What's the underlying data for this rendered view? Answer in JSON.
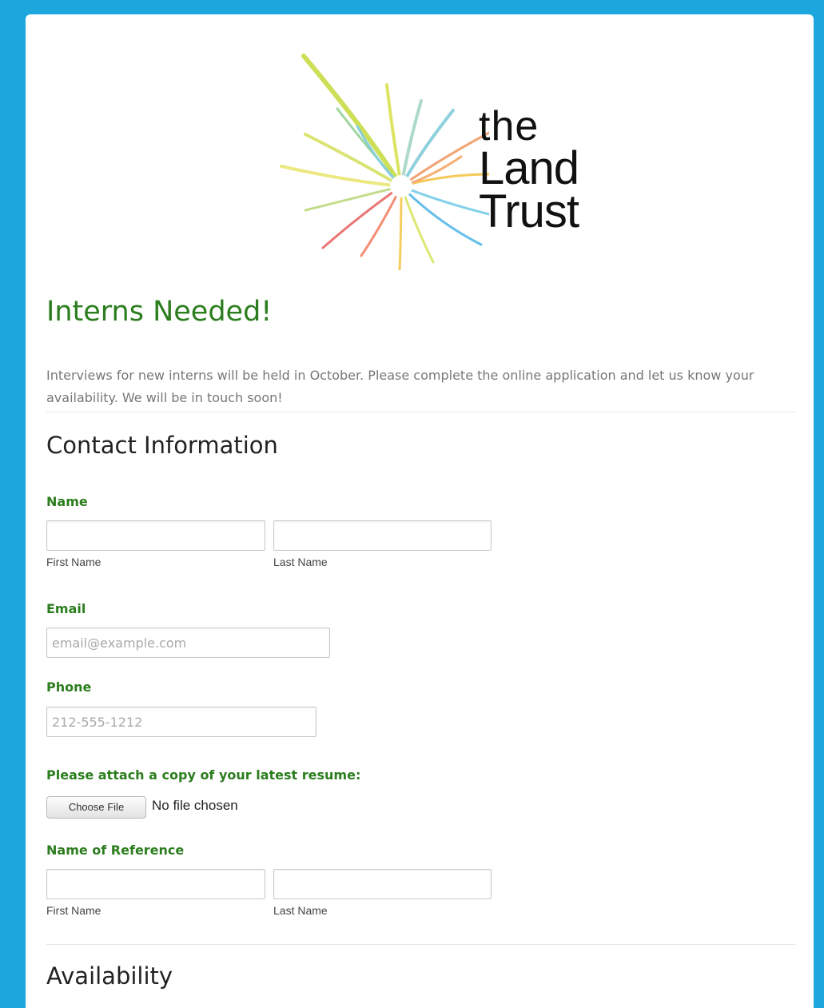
{
  "logo": {
    "word1": "the",
    "word2": "Land",
    "word3": "Trust"
  },
  "title": "Interns Needed!",
  "intro": "Interviews for new interns will be held in October. Please complete the online application and let us know your availability. We will be in touch soon!",
  "contact_section": {
    "heading": "Contact Information",
    "name": {
      "label": "Name",
      "first_sublabel": "First Name",
      "last_sublabel": "Last Name",
      "first_value": "",
      "last_value": ""
    },
    "email": {
      "label": "Email",
      "placeholder": "email@example.com",
      "value": ""
    },
    "phone": {
      "label": "Phone",
      "placeholder": "212-555-1212",
      "value": ""
    },
    "resume": {
      "label": "Please attach a copy of your latest resume:",
      "button": "Choose File",
      "status": "No file chosen"
    },
    "reference": {
      "label": "Name of Reference",
      "first_sublabel": "First Name",
      "last_sublabel": "Last Name",
      "first_value": "",
      "last_value": ""
    }
  },
  "availability_section": {
    "heading": "Availability"
  },
  "colors": {
    "frame": "#1ba7dd",
    "accent_green": "#2b7d1e",
    "text_gray": "#777777"
  }
}
